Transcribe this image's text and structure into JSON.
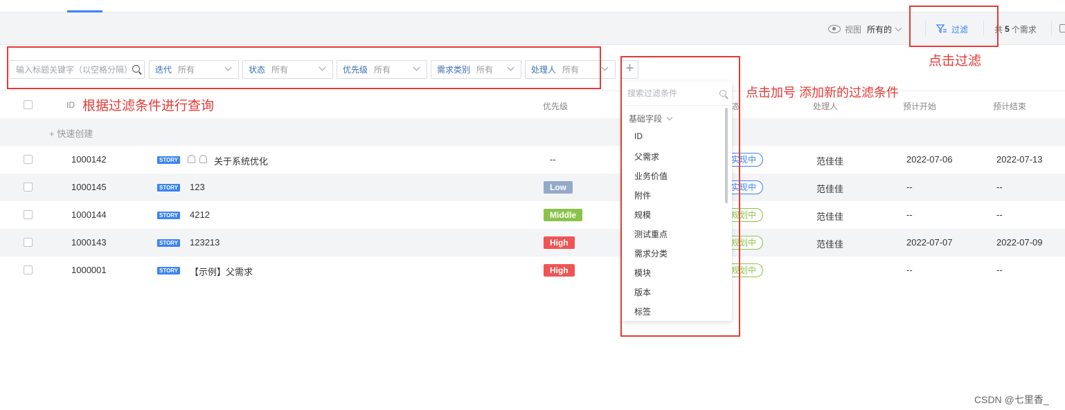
{
  "toolbar": {
    "view_label": "视图",
    "view_value": "所有的",
    "filter_label": "过滤",
    "count_prefix": "共",
    "count_value": "5",
    "count_suffix": "个需求"
  },
  "filters": {
    "search_placeholder": "输入标题关键字（以空格分隔）",
    "selects": [
      {
        "key": "迭代",
        "value": "所有"
      },
      {
        "key": "状态",
        "value": "所有"
      },
      {
        "key": "优先级",
        "value": "所有"
      },
      {
        "key": "需求类别",
        "value": "所有"
      },
      {
        "key": "处理人",
        "value": "所有"
      }
    ],
    "add_symbol": "+"
  },
  "table": {
    "headers": {
      "id": "ID",
      "priority": "优先级",
      "status_tail": "态",
      "assignee": "处理人",
      "start": "预计开始",
      "end": "预计结束"
    },
    "quick_create": "+ 快速创建",
    "rows": [
      {
        "id": "1000142",
        "tag": "STORY",
        "title": "关于系统优化",
        "priority": "--",
        "status": "实现中",
        "assignee": "范佳佳",
        "start": "2022-07-06",
        "end": "2022-07-13"
      },
      {
        "id": "1000145",
        "tag": "STORY",
        "title": "123",
        "priority": "Low",
        "status": "实现中",
        "assignee": "范佳佳",
        "start": "--",
        "end": "--"
      },
      {
        "id": "1000144",
        "tag": "STORY",
        "title": "4212",
        "priority": "Middle",
        "status": "规划中",
        "assignee": "范佳佳",
        "start": "--",
        "end": "--"
      },
      {
        "id": "1000143",
        "tag": "STORY",
        "title": "123213",
        "priority": "High",
        "status": "规划中",
        "assignee": "范佳佳",
        "start": "2022-07-07",
        "end": "2022-07-09"
      },
      {
        "id": "1000001",
        "tag": "STORY",
        "title": "【示例】父需求",
        "priority": "High",
        "status": "规划中",
        "assignee": "",
        "start": "--",
        "end": "--"
      }
    ]
  },
  "dropdown": {
    "search_placeholder": "搜索过滤条件",
    "group_label": "基础字段",
    "items": [
      "ID",
      "父需求",
      "业务价值",
      "附件",
      "规模",
      "测试重点",
      "需求分类",
      "模块",
      "版本",
      "标签"
    ]
  },
  "annotations": {
    "filter_query": "根据过滤条件进行查询",
    "click_filter": "点击过滤",
    "click_plus": "点击加号 添加新的过滤条件"
  },
  "watermark": "CSDN @七里香_",
  "colors": {
    "accent": "#3b82f6",
    "priority_low": "#94a9c9",
    "priority_middle": "#8bc34a",
    "priority_high": "#f05454",
    "annotation_red": "#e53935"
  }
}
